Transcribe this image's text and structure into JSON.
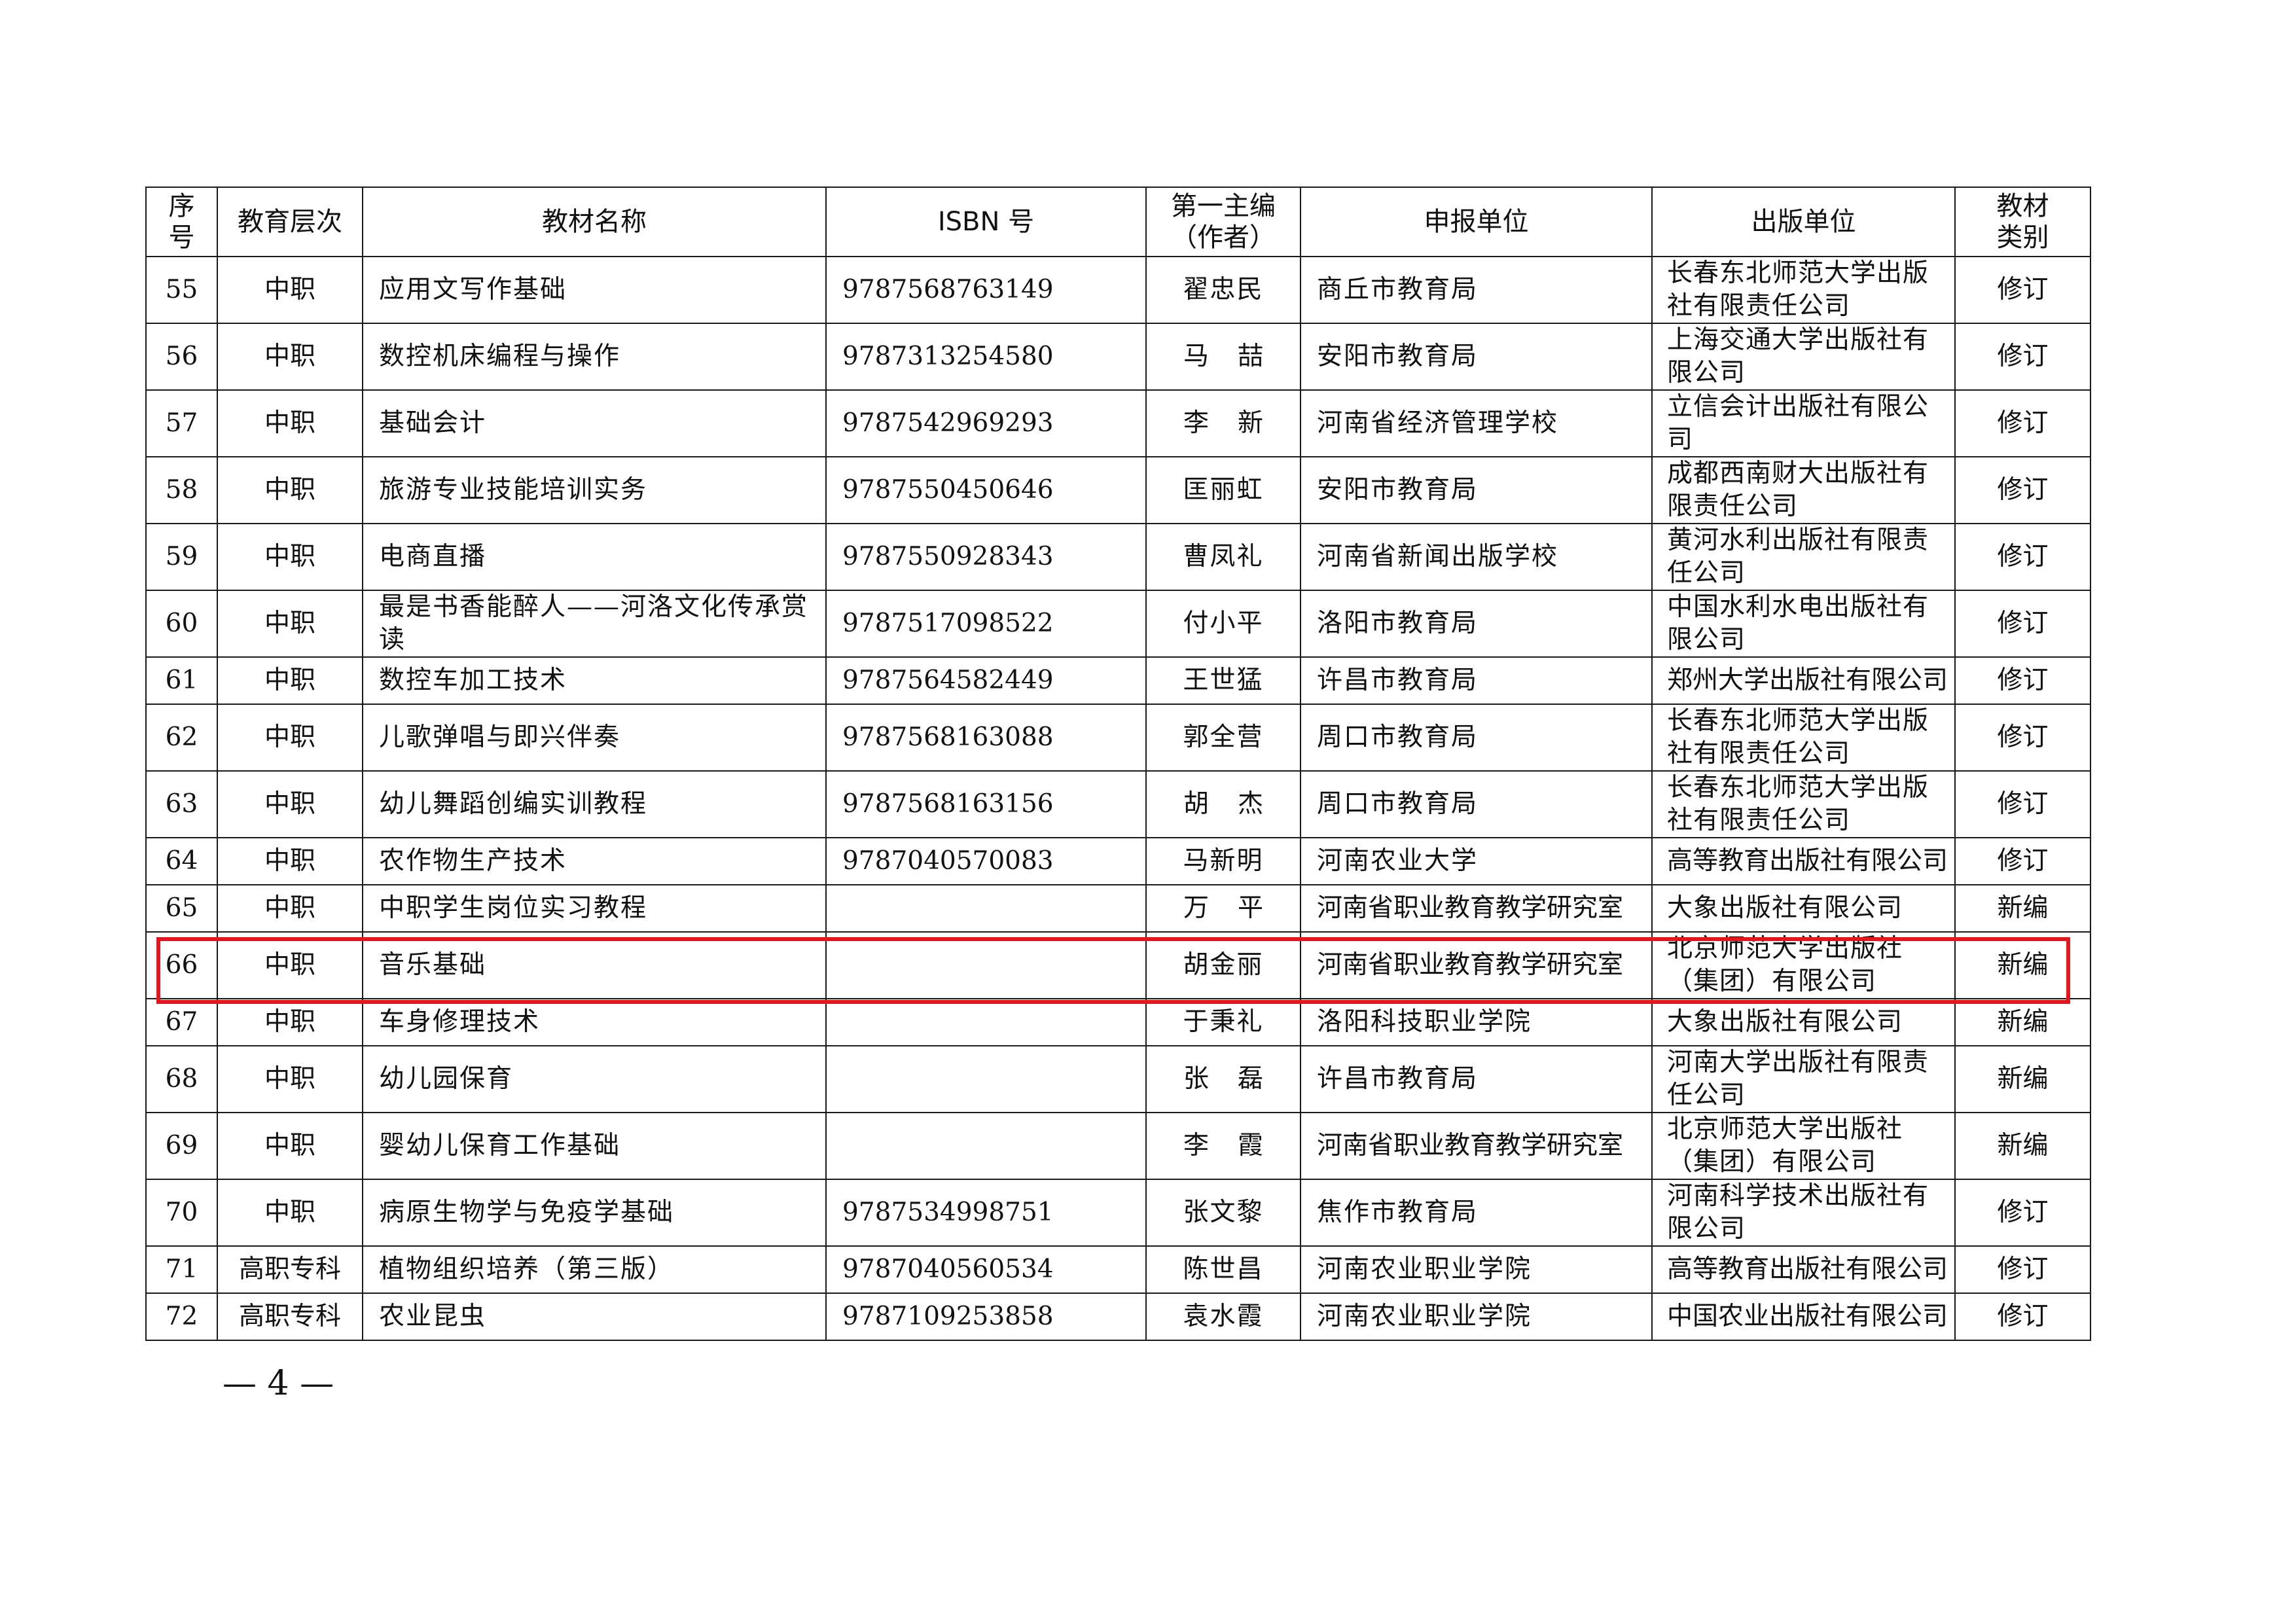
{
  "headers": {
    "seq": "序号",
    "level": "教育层次",
    "title": "教材名称",
    "isbn": "ISBN 号",
    "editor": "第一主编（作者）",
    "unit": "申报单位",
    "publisher": "出版单位",
    "category": "教材类别"
  },
  "rows": [
    {
      "seq": "55",
      "level": "中职",
      "title": "应用文写作基础",
      "isbn": "9787568763149",
      "editor": "翟忠民",
      "unit": "商丘市教育局",
      "publisher": "长春东北师范大学出版社有限责任公司",
      "category": "修订"
    },
    {
      "seq": "56",
      "level": "中职",
      "title": "数控机床编程与操作",
      "isbn": "9787313254580",
      "editor": "马喆",
      "unit": "安阳市教育局",
      "publisher": "上海交通大学出版社有限公司",
      "category": "修订"
    },
    {
      "seq": "57",
      "level": "中职",
      "title": "基础会计",
      "isbn": "9787542969293",
      "editor": "李新",
      "unit": "河南省经济管理学校",
      "publisher": "立信会计出版社有限公司",
      "category": "修订"
    },
    {
      "seq": "58",
      "level": "中职",
      "title": "旅游专业技能培训实务",
      "isbn": "9787550450646",
      "editor": "匡丽虹",
      "unit": "安阳市教育局",
      "publisher": "成都西南财大出版社有限责任公司",
      "category": "修订"
    },
    {
      "seq": "59",
      "level": "中职",
      "title": "电商直播",
      "isbn": "9787550928343",
      "editor": "曹凤礼",
      "unit": "河南省新闻出版学校",
      "publisher": "黄河水利出版社有限责任公司",
      "category": "修订"
    },
    {
      "seq": "60",
      "level": "中职",
      "title": "最是书香能醉人——河洛文化传承赏读",
      "isbn": "9787517098522",
      "editor": "付小平",
      "unit": "洛阳市教育局",
      "publisher": "中国水利水电出版社有限公司",
      "category": "修订"
    },
    {
      "seq": "61",
      "level": "中职",
      "title": "数控车加工技术",
      "isbn": "9787564582449",
      "editor": "王世猛",
      "unit": "许昌市教育局",
      "publisher": "郑州大学出版社有限公司",
      "category": "修订"
    },
    {
      "seq": "62",
      "level": "中职",
      "title": "儿歌弹唱与即兴伴奏",
      "isbn": "9787568163088",
      "editor": "郭全营",
      "unit": "周口市教育局",
      "publisher": "长春东北师范大学出版社有限责任公司",
      "category": "修订"
    },
    {
      "seq": "63",
      "level": "中职",
      "title": "幼儿舞蹈创编实训教程",
      "isbn": "9787568163156",
      "editor": "胡杰",
      "unit": "周口市教育局",
      "publisher": "长春东北师范大学出版社有限责任公司",
      "category": "修订"
    },
    {
      "seq": "64",
      "level": "中职",
      "title": "农作物生产技术",
      "isbn": "9787040570083",
      "editor": "马新明",
      "unit": "河南农业大学",
      "publisher": "高等教育出版社有限公司",
      "category": "修订"
    },
    {
      "seq": "65",
      "level": "中职",
      "title": "中职学生岗位实习教程",
      "isbn": "",
      "editor": "万平",
      "unit": "河南省职业教育教学研究室",
      "publisher": "大象出版社有限公司",
      "category": "新编"
    },
    {
      "seq": "66",
      "level": "中职",
      "title": "音乐基础",
      "isbn": "",
      "editor": "胡金丽",
      "unit": "河南省职业教育教学研究室",
      "publisher": "北京师范大学出版社（集团）有限公司",
      "category": "新编"
    },
    {
      "seq": "67",
      "level": "中职",
      "title": "车身修理技术",
      "isbn": "",
      "editor": "于秉礼",
      "unit": "洛阳科技职业学院",
      "publisher": "大象出版社有限公司",
      "category": "新编"
    },
    {
      "seq": "68",
      "level": "中职",
      "title": "幼儿园保育",
      "isbn": "",
      "editor": "张磊",
      "unit": "许昌市教育局",
      "publisher": "河南大学出版社有限责任公司",
      "category": "新编"
    },
    {
      "seq": "69",
      "level": "中职",
      "title": "婴幼儿保育工作基础",
      "isbn": "",
      "editor": "李霞",
      "unit": "河南省职业教育教学研究室",
      "publisher": "北京师范大学出版社（集团）有限公司",
      "category": "新编"
    },
    {
      "seq": "70",
      "level": "中职",
      "title": "病原生物学与免疫学基础",
      "isbn": "9787534998751",
      "editor": "张文黎",
      "unit": "焦作市教育局",
      "publisher": "河南科学技术出版社有限公司",
      "category": "修订"
    },
    {
      "seq": "71",
      "level": "高职专科",
      "title": "植物组织培养（第三版）",
      "isbn": "9787040560534",
      "editor": "陈世昌",
      "unit": "河南农业职业学院",
      "publisher": "高等教育出版社有限公司",
      "category": "修订"
    },
    {
      "seq": "72",
      "level": "高职专科",
      "title": "农业昆虫",
      "isbn": "9787109253858",
      "editor": "袁水霞",
      "unit": "河南农业职业学院",
      "publisher": "中国农业出版社有限公司",
      "category": "修订"
    }
  ],
  "footer": {
    "page_number": "— 4 —"
  },
  "colors": {
    "highlight_border": "#e3161e",
    "table_border": "#1a1a1a",
    "text": "#111111"
  }
}
